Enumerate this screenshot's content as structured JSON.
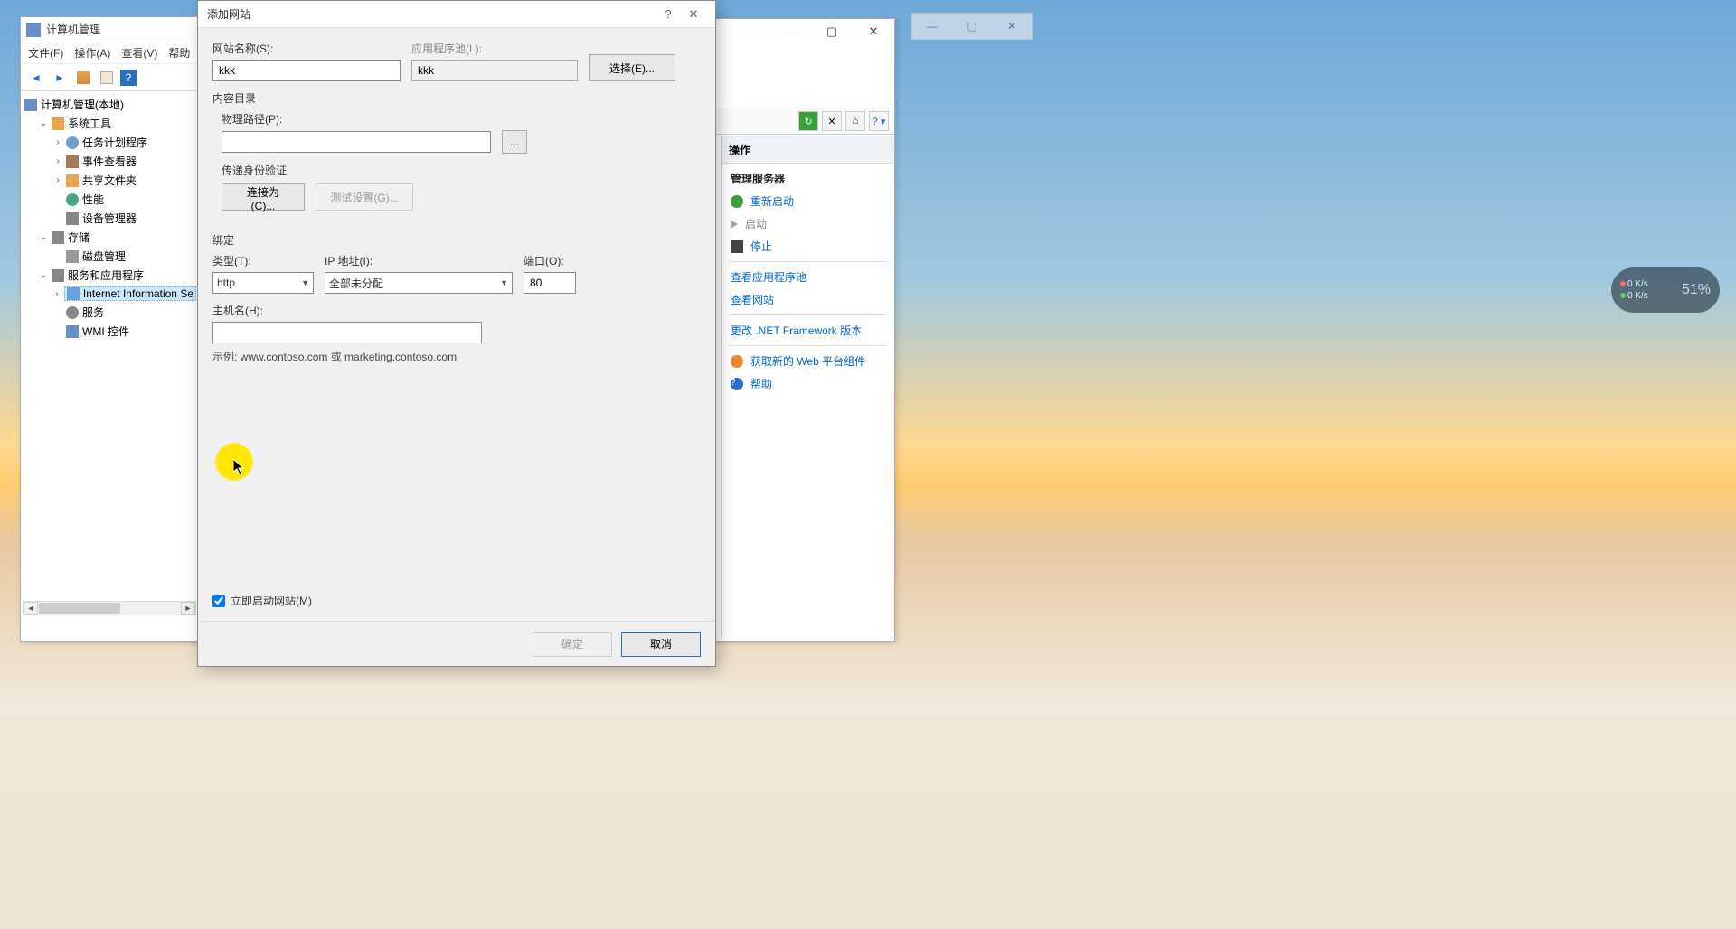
{
  "mgmt": {
    "title": "计算机管理",
    "menu": [
      "文件(F)",
      "操作(A)",
      "查看(V)",
      "帮助"
    ],
    "tree": {
      "root": "计算机管理(本地)",
      "tools": "系统工具",
      "task": "任务计划程序",
      "event": "事件查看器",
      "share": "共享文件夹",
      "perf": "性能",
      "device": "设备管理器",
      "storage": "存储",
      "disk": "磁盘管理",
      "services_apps": "服务和应用程序",
      "iis": "Internet Information Se",
      "svc": "服务",
      "wmi": "WMI 控件"
    }
  },
  "iis": {
    "actions_header": "操作",
    "manage_server": "管理服务器",
    "restart": "重新启动",
    "start": "启动",
    "stop": "停止",
    "view_apppool": "查看应用程序池",
    "view_sites": "查看网站",
    "change_net": "更改 .NET Framework 版本",
    "get_webplatform": "获取新的 Web 平台组件",
    "help": "帮助"
  },
  "dialog": {
    "title": "添加网站",
    "site_name_label": "网站名称(S):",
    "site_name_value": "kkk",
    "app_pool_label": "应用程序池(L):",
    "app_pool_value": "kkk",
    "select_btn": "选择(E)...",
    "content_dir": "内容目录",
    "physical_path_label": "物理路径(P):",
    "physical_path_value": "",
    "browse_btn": "...",
    "auth_label": "传递身份验证",
    "connect_as_btn": "连接为(C)...",
    "test_settings_btn": "测试设置(G)...",
    "binding": "绑定",
    "type_label": "类型(T):",
    "type_value": "http",
    "ip_label": "IP 地址(I):",
    "ip_value": "全部未分配",
    "port_label": "端口(O):",
    "port_value": "80",
    "hostname_label": "主机名(H):",
    "hostname_value": "",
    "example": "示例: www.contoso.com 或 marketing.contoso.com",
    "auto_start": "立即启动网站(M)",
    "ok": "确定",
    "cancel": "取消"
  },
  "widget": {
    "up": "0 K/s",
    "down": "0 K/s",
    "pct": "51%"
  }
}
